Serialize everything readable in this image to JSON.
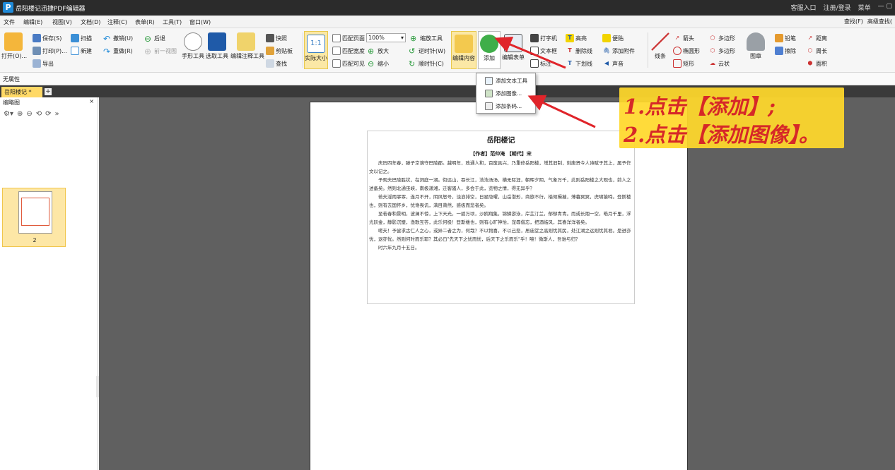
{
  "app": {
    "title": "岳阳楼记迅捷PDF编辑器",
    "logo": "P",
    "title_right": [
      "客服入口",
      "注册/登录",
      "菜单",
      "—  ▢"
    ]
  },
  "menu": {
    "items": [
      "文件",
      "编辑(E)",
      "视图(V)",
      "文档(D)",
      "注释(C)",
      "表单(R)",
      "工具(T)",
      "窗口(W)"
    ],
    "right": [
      "查找(F)",
      "高级查找("
    ]
  },
  "ribbon": {
    "open": "打开(O)...",
    "save": "保存(S)",
    "print": "打印(P)...",
    "export": "导出",
    "scan": "扫描",
    "new": "新建",
    "undo": "撤销(U)",
    "redo": "重做(R)",
    "back": "后退",
    "prev_view": "前一视图",
    "hand_tool": "手形工具",
    "select_tool": "选取工具",
    "edit_annot_tool": "编辑注释工具",
    "snapshot": "快照",
    "clipboard": "剪贴板",
    "find": "查找",
    "actual_size": "实际大小",
    "actual_size_icon": "1:1",
    "fit_page": "匹配页面",
    "fit_width": "匹配宽度",
    "fit_visible": "匹配可见",
    "zoom_value": "100%",
    "zoom_tool": "缩放工具",
    "zoom_in": "放大",
    "zoom_out": "缩小",
    "rotate_ccw": "逆时针(W)",
    "rotate_cw": "顺时针(C)",
    "edit_content": "编辑内容",
    "add": "添加",
    "edit_form": "编辑表单",
    "typewriter": "打字机",
    "text_box": "文本框",
    "callout": "标注",
    "highlight": "高亮",
    "strikeout": "删除线",
    "underline": "下划线",
    "sticky_note": "便贴",
    "attach_file": "添加附件",
    "sound": "声音",
    "line": "线条",
    "arrow": "箭头",
    "ellipse": "椭圆形",
    "rectangle": "矩形",
    "polygon": "多边形",
    "polyline": "多边形",
    "cloud": "云状",
    "stamp": "图章",
    "pencil": "铅笔",
    "eraser": "擦除",
    "distance": "距离",
    "perimeter": "周长",
    "area": "面积"
  },
  "properties": {
    "label": "无属性"
  },
  "tabs": {
    "doc": "岳阳楼记 *",
    "close": "×",
    "add": "+"
  },
  "sidebar": {
    "title": "缩略图",
    "close": "×",
    "page_label": "2"
  },
  "dropdown": {
    "items": [
      "添加文本工具",
      "添加图像...",
      "添加条码..."
    ]
  },
  "annotation": {
    "line1": "1.点击【添加】;",
    "line2": "2.点击【添加图像】。"
  },
  "document": {
    "title": "岳阳楼记",
    "author": "【作者】范仲淹 【朝代】宋",
    "body": "　　庆历四年春，滕子京谪守巴陵郡。越明年，政通人和，百废具兴，乃重修岳阳楼，增其旧制，刻唐贤今人诗赋于其上，属予作文以记之。\n　　予观夫巴陵胜状，在洞庭一湖。衔远山，吞长江，浩浩汤汤，横无际涯，朝晖夕阴，气象万千，此则岳阳楼之大观也，前人之述备矣。然则北通巫峡，南极潇湘，迁客骚人，多会于此，览物之情，得无异乎？\n　　若夫淫雨霏霏，连月不开，阴风怒号，浊浪排空，日星隐曜，山岳潜形，商旅不行，樯倾楫摧，薄暮冥冥，虎啸猿啼。登斯楼也，则有去国怀乡，忧谗畏讥，满目萧然，感极而悲者矣。\n　　至若春和景明，波澜不惊，上下天光，一碧万顷，沙鸥翔集，锦鳞游泳，岸芷汀兰，郁郁青青。而或长烟一空，皓月千里，浮光跃金，静影沉璧，渔歌互答，此乐何极！登斯楼也，则有心旷神怡，宠辱偕忘，把酒临风，其喜洋洋者矣。\n　　嗟夫！予尝求古仁人之心，或异二者之为，何哉？不以物喜，不以己悲，居庙堂之高则忧其民，处江湖之远则忧其君。是进亦忧，退亦忧。然则何时而乐耶？其必曰\"先天下之忧而忧，后天下之乐而乐\"乎！噫！微斯人，吾谁与归？\n　　时六年九月十五日。"
  },
  "colors": {
    "accent": "#1f8ad8",
    "highlight": "#fbe8a6",
    "annotation_bg": "#ffd82b",
    "annotation_text": "#d62828",
    "arrow": "#e0242a"
  }
}
